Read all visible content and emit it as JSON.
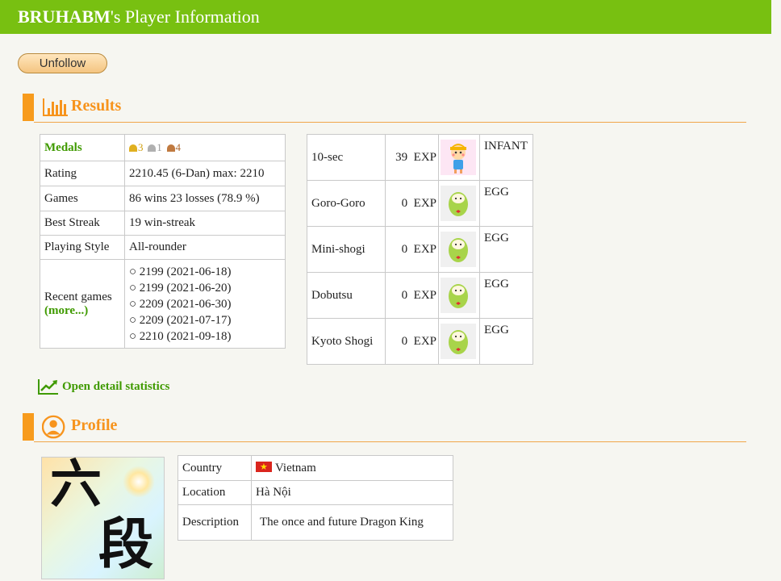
{
  "header": {
    "player_name": "BRUHABM",
    "title_suffix": "'s Player Information"
  },
  "actions": {
    "unfollow_label": "Unfollow"
  },
  "results": {
    "heading": "Results",
    "rows": {
      "medals_label": "Medals",
      "medals": {
        "gold": "3",
        "silver": "1",
        "bronze": "4"
      },
      "rating_label": "Rating",
      "rating_value": "2210.45 (6-Dan) max: 2210",
      "games_label": "Games",
      "games_value": "86 wins 23 losses (78.9 %)",
      "best_streak_label": "Best Streak",
      "best_streak_value": "19 win-streak",
      "style_label": "Playing Style",
      "style_value": "All-rounder",
      "recent_label": "Recent games",
      "recent_more": "(more...)",
      "recent_games": [
        "○ 2199 (2021-06-18)",
        "○ 2199 (2021-06-20)",
        "○ 2209 (2021-06-30)",
        "○ 2209 (2021-07-17)",
        "○ 2210 (2021-09-18)"
      ]
    },
    "exp_rows": [
      {
        "mode": "10-sec",
        "exp": "39",
        "unit": "EXP",
        "level": "INFANT"
      },
      {
        "mode": "Goro-Goro",
        "exp": "0",
        "unit": "EXP",
        "level": "EGG"
      },
      {
        "mode": "Mini-shogi",
        "exp": "0",
        "unit": "EXP",
        "level": "EGG"
      },
      {
        "mode": "Dobutsu",
        "exp": "0",
        "unit": "EXP",
        "level": "EGG"
      },
      {
        "mode": "Kyoto Shogi",
        "exp": "0",
        "unit": "EXP",
        "level": "EGG"
      }
    ],
    "detail_link": "Open detail statistics"
  },
  "profile": {
    "heading": "Profile",
    "avatar_text": {
      "top": "六",
      "bottom": "段"
    },
    "country_label": "Country",
    "country_value": "Vietnam",
    "location_label": "Location",
    "location_value": "Hà Nội",
    "description_label": "Description",
    "description_value": "The once and future Dragon King"
  },
  "colors": {
    "header_bg": "#78c011",
    "accent_orange": "#f7941d",
    "link_green": "#3f9a00",
    "medal_gold": "#e0b020",
    "medal_silver": "#b0b0b0",
    "medal_bronze": "#c07a40"
  }
}
